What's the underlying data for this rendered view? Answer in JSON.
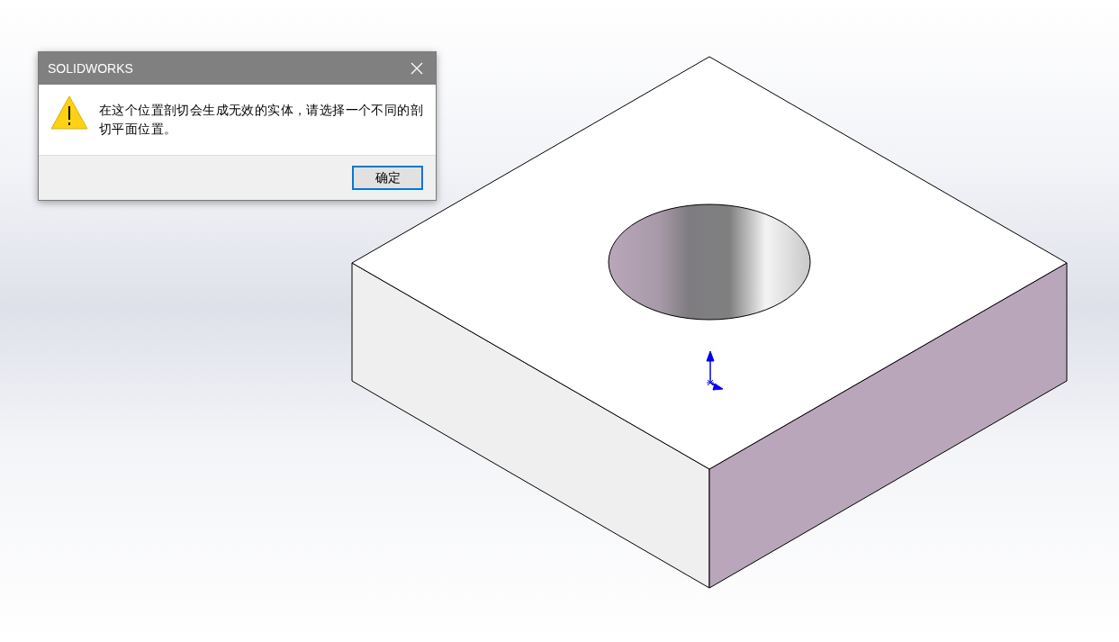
{
  "dialog": {
    "title": "SOLIDWORKS",
    "message": "在这个位置剖切会生成无效的实体，请选择一个不同的剖切平面位置。",
    "buttons": [
      {
        "label": "确定",
        "selected": true
      }
    ]
  }
}
